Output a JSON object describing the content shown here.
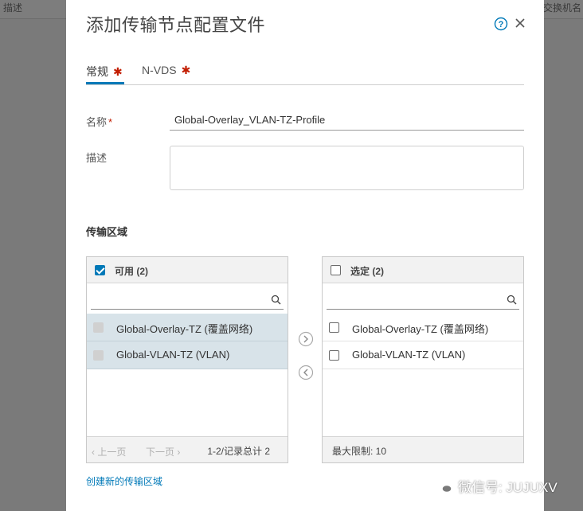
{
  "background": {
    "left_header": "描述",
    "right_header": "交换机名"
  },
  "modal": {
    "title": "添加传输节点配置文件",
    "help_icon": "help-circle-icon",
    "close_icon": "close-icon"
  },
  "tabs": [
    {
      "label": "常规",
      "required": "✱"
    },
    {
      "label": "N-VDS",
      "required": "✱"
    }
  ],
  "form": {
    "name_label": "名称",
    "name_required": "*",
    "name_value": "Global-Overlay_VLAN-TZ-Profile",
    "desc_label": "描述",
    "desc_value": ""
  },
  "transport_zones": {
    "section_title": "传输区域",
    "available": {
      "header": "可用 (2)",
      "search_value": "",
      "items": [
        {
          "label": "Global-Overlay-TZ (覆盖网络)"
        },
        {
          "label": "Global-VLAN-TZ (VLAN)"
        }
      ],
      "prev_page": "上一页",
      "next_page": "下一页",
      "page_info": "1-2/记录总计 2"
    },
    "selected": {
      "header": "选定 (2)",
      "search_value": "",
      "items": [
        {
          "label": "Global-Overlay-TZ (覆盖网络)"
        },
        {
          "label": "Global-VLAN-TZ (VLAN)"
        }
      ],
      "limit": "最大限制: 10"
    },
    "create_link": "创建新的传输区域"
  },
  "watermark": "微信号: JUJUXV",
  "colors": {
    "accent": "#0079b8",
    "required": "#c21d00",
    "selected_row": "#d8e3e9",
    "overlay": "#7a7a7a"
  }
}
